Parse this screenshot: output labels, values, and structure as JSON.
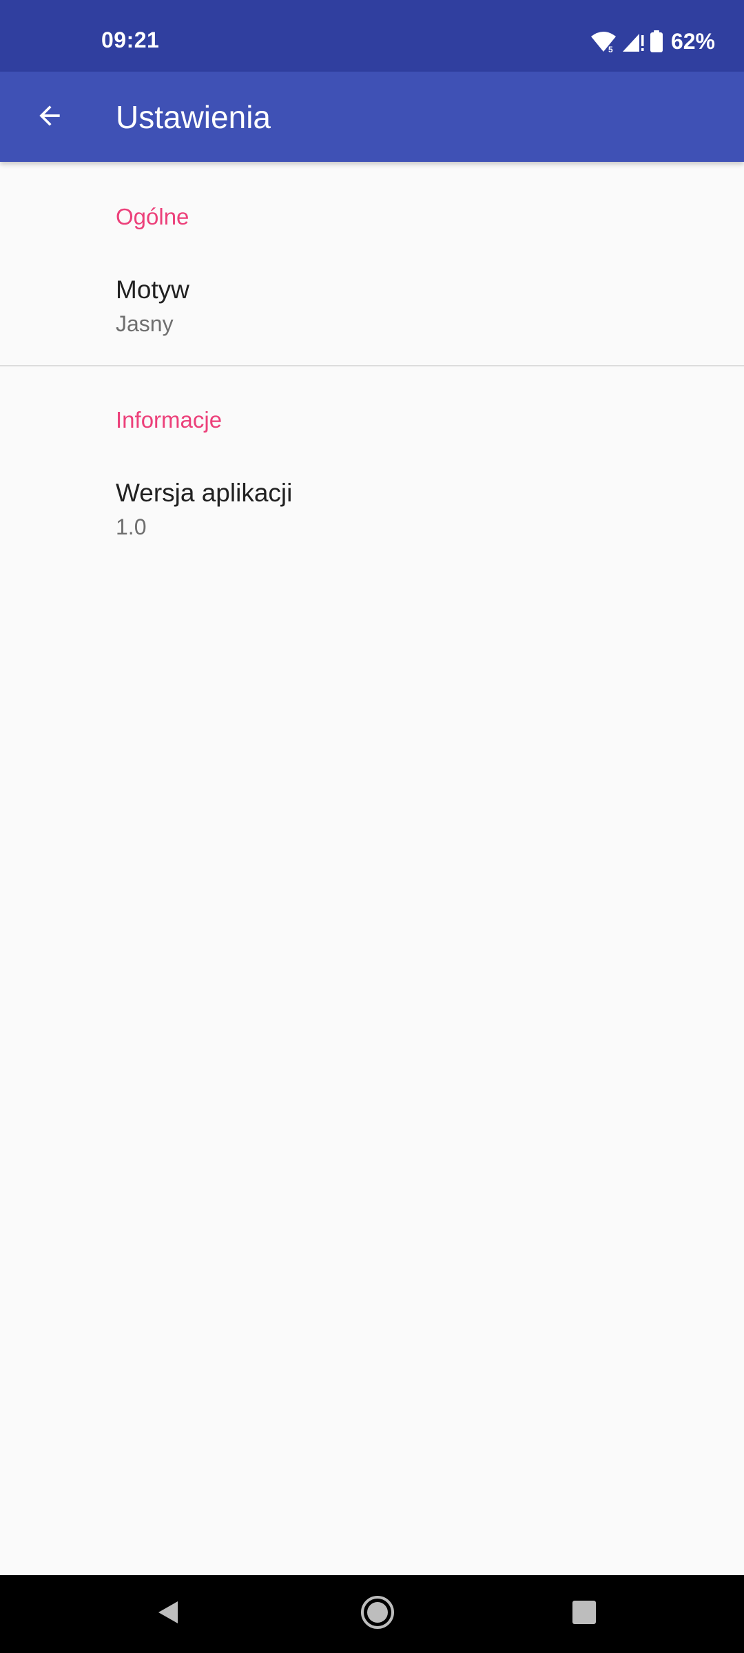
{
  "status_bar": {
    "time": "09:21",
    "battery_percent": "62%",
    "wifi_label": "5",
    "icons": [
      "wifi-icon",
      "cell-signal-icon",
      "battery-icon"
    ]
  },
  "app_bar": {
    "title": "Ustawienia",
    "back_icon": "arrow-back-icon"
  },
  "sections": [
    {
      "header": "Ogólne",
      "items": [
        {
          "title": "Motyw",
          "summary": "Jasny"
        }
      ]
    },
    {
      "header": "Informacje",
      "items": [
        {
          "title": "Wersja aplikacji",
          "summary": "1.0"
        }
      ]
    }
  ],
  "nav_bar": {
    "icons": [
      "nav-back-icon",
      "nav-home-icon",
      "nav-recents-icon"
    ]
  },
  "colors": {
    "status_bar": "#303f9f",
    "app_bar": "#3f51b5",
    "accent": "#ec407a",
    "background": "#fafafa"
  }
}
